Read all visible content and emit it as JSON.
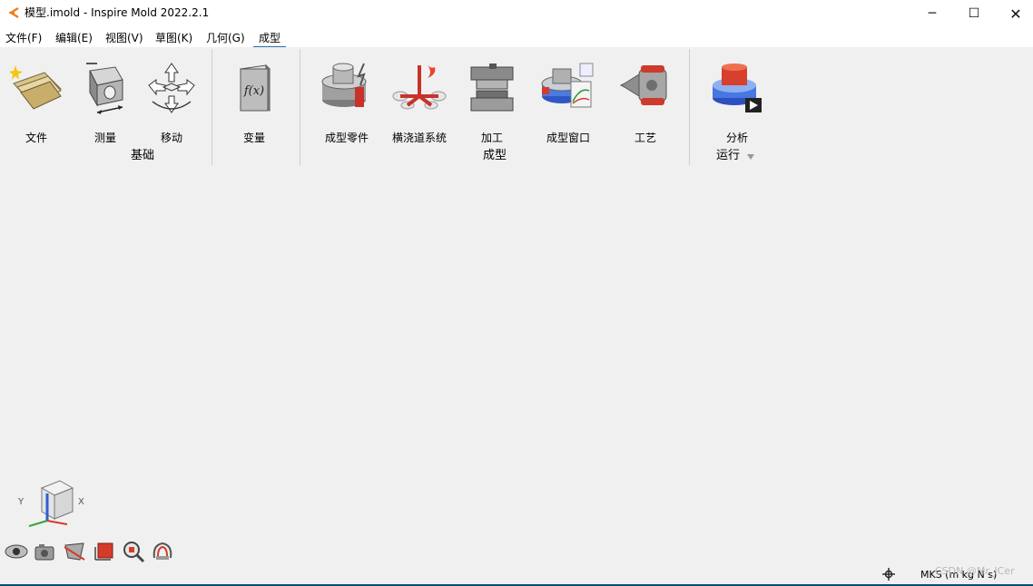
{
  "window": {
    "title": "模型.imold - Inspire Mold 2022.2.1",
    "controls": {
      "minimize": "─",
      "maximize": "☐",
      "close": "✕"
    }
  },
  "menu": [
    {
      "label": "文件(F)",
      "active": false
    },
    {
      "label": "编辑(E)",
      "active": false
    },
    {
      "label": "视图(V)",
      "active": false
    },
    {
      "label": "草图(K)",
      "active": false
    },
    {
      "label": "几何(G)",
      "active": false
    },
    {
      "label": "成型",
      "active": true
    }
  ],
  "ribbon": {
    "groups": [
      {
        "label": "基础",
        "tools": [
          {
            "label": "文件",
            "icon": "file-folder-icon"
          },
          {
            "label": "测量",
            "icon": "measure-icon"
          },
          {
            "label": "移动",
            "icon": "move-arrows-icon"
          }
        ]
      },
      {
        "label": "",
        "tools": [
          {
            "label": "变量",
            "icon": "function-fx-icon",
            "icon_text": "f(x)"
          }
        ]
      },
      {
        "label": "成型",
        "tools": [
          {
            "label": "成型零件",
            "icon": "molded-part-icon"
          },
          {
            "label": "横浇道系统",
            "icon": "runner-system-icon"
          },
          {
            "label": "加工",
            "icon": "machining-icon"
          },
          {
            "label": "成型窗口",
            "icon": "molding-window-icon"
          },
          {
            "label": "工艺",
            "icon": "process-icon"
          }
        ]
      },
      {
        "label": "运行",
        "tools": [
          {
            "label": "分析",
            "icon": "analysis-run-icon"
          }
        ]
      }
    ]
  },
  "viewcube": {
    "axis_x": "X",
    "axis_y": "Y"
  },
  "bottom_toolbar": [
    "visibility-eye-icon",
    "camera-icon",
    "section-cut-icon",
    "view-box-icon",
    "zoom-fit-icon",
    "3d-view-icon"
  ],
  "status": {
    "units": "MKS (m kg N s)",
    "watermark": "CSDN @Mr_ICer"
  },
  "colors": {
    "titlebar": "#ffffff",
    "background": "#f0f0f0",
    "accent": "#2a6fb5",
    "separator": "#cfcfcf"
  }
}
